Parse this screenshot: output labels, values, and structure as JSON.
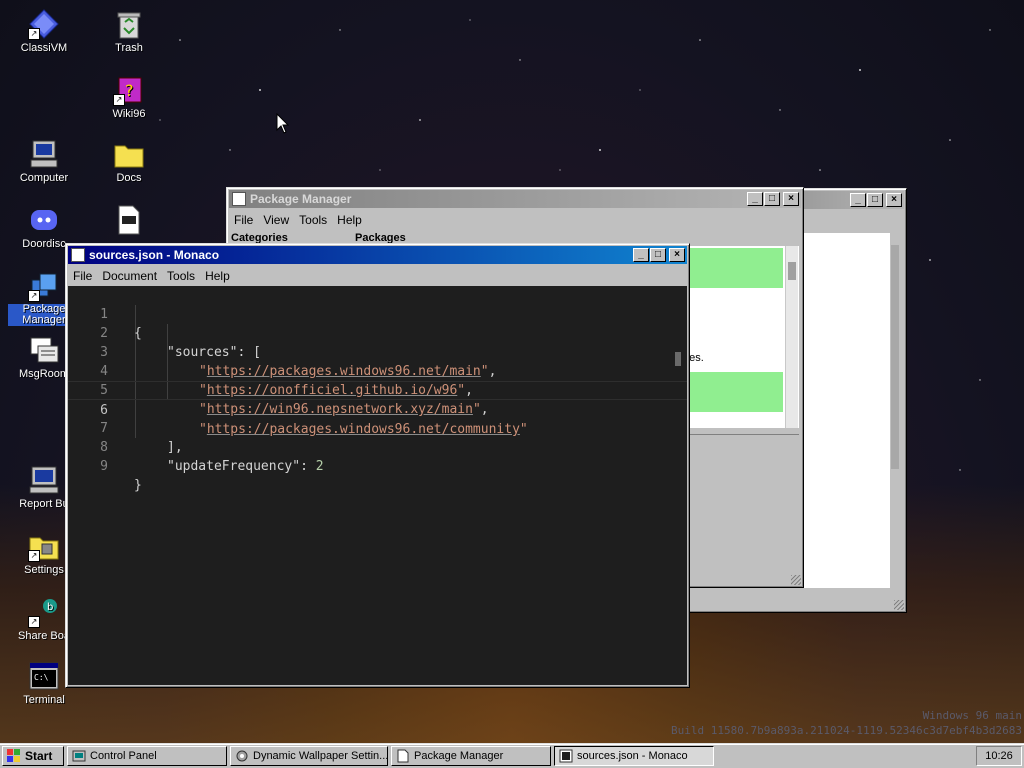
{
  "desktop": {
    "icons": [
      {
        "label": "ClassiVM"
      },
      {
        "label": "Trash"
      },
      {
        "label": "Wiki96"
      },
      {
        "label": "Computer"
      },
      {
        "label": "Docs"
      },
      {
        "label": "Doordisc"
      },
      {
        "label": "Package Manager"
      },
      {
        "label": "MsgRoom"
      },
      {
        "label": "Report Bu"
      },
      {
        "label": "Settings"
      },
      {
        "label": "Share Boa"
      },
      {
        "label": "Terminal"
      }
    ]
  },
  "back_window": {
    "title": ""
  },
  "package_manager": {
    "title": "Package Manager",
    "menu": [
      "File",
      "View",
      "Tools",
      "Help"
    ],
    "categories_label": "Categories",
    "packages_label": "Packages",
    "fragment_text": "ges."
  },
  "editor_window": {
    "title": "sources.json - Monaco",
    "menu": [
      "File",
      "Document",
      "Tools",
      "Help"
    ],
    "lines": [
      {
        "n": "1",
        "text": "{"
      },
      {
        "n": "2",
        "key": "\"sources\"",
        "rest": ": ["
      },
      {
        "n": "3",
        "q1": "\"",
        "url": "https://packages.windows96.net/main",
        "q2": "\"",
        "tail": ","
      },
      {
        "n": "4",
        "q1": "\"",
        "url": "https://onofficiel.github.io/w96",
        "q2": "\"",
        "tail": ","
      },
      {
        "n": "5",
        "q1": "\"",
        "url": "https://win96.nepsnetwork.xyz/main",
        "q2": "\"",
        "tail": ","
      },
      {
        "n": "6",
        "q1": "\"",
        "url": "https://packages.windows96.net/community",
        "q2": "\"",
        "tail": ""
      },
      {
        "n": "7",
        "text": "],"
      },
      {
        "n": "8",
        "key": "\"updateFrequency\"",
        "rest": ": ",
        "num": "2"
      },
      {
        "n": "9",
        "text": "}"
      }
    ]
  },
  "watermark": {
    "line1": "Windows 96 main",
    "line2": "Build 11580.7b9a893a.211024-1119.52346c3d7ebf4b3d2683"
  },
  "taskbar": {
    "start": "Start",
    "items": [
      {
        "label": "Control Panel"
      },
      {
        "label": "Dynamic Wallpaper Settin..."
      },
      {
        "label": "Package Manager"
      },
      {
        "label": "sources.json - Monaco"
      }
    ],
    "clock": "10:26"
  },
  "colors": {
    "titlebar_active": "#000080",
    "green_row": "#90ee90",
    "editor_bg": "#1e1e1e",
    "string": "#ce9178",
    "number": "#b5cea8"
  }
}
